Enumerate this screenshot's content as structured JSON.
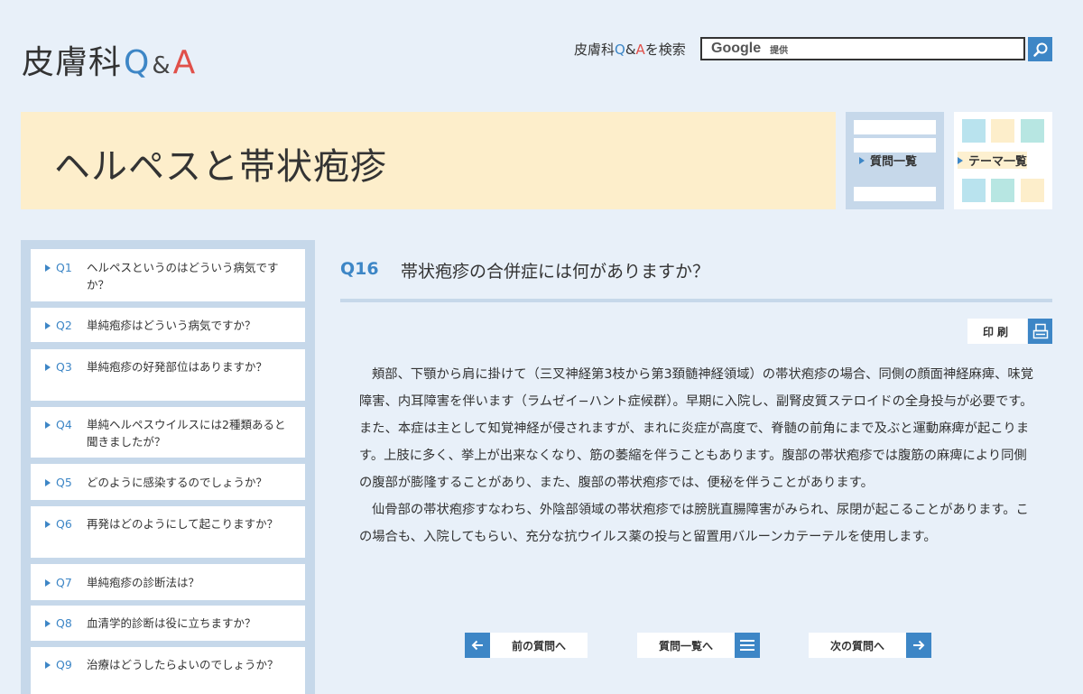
{
  "header": {
    "logo": {
      "main": "皮膚科",
      "q": "Q",
      "amp": "&",
      "a": "A"
    },
    "search": {
      "label_pre": "皮膚科",
      "label_q": "Q",
      "label_amp": "&",
      "label_a": "A",
      "label_post": "を検索",
      "brand": "Google",
      "brand_suffix": "提供"
    }
  },
  "banner": {
    "title": "ヘルペスと帯状疱疹",
    "question_list_label": "質問一覧",
    "theme_list_label": "テーマ一覧"
  },
  "sidebar": {
    "items": [
      {
        "num": "Q1",
        "text": "ヘルペスというのはどういう病気ですか？"
      },
      {
        "num": "Q2",
        "text": "単純疱疹はどういう病気ですか？"
      },
      {
        "num": "Q3",
        "text": "単純疱疹の好発部位はありますか？"
      },
      {
        "num": "Q4",
        "text": "単純ヘルペスウイルスには2種類あると聞きましたが？"
      },
      {
        "num": "Q5",
        "text": "どのように感染するのでしょうか？"
      },
      {
        "num": "Q6",
        "text": "再発はどのようにして起こりますか？"
      },
      {
        "num": "Q7",
        "text": "単純疱疹の診断法は？"
      },
      {
        "num": "Q8",
        "text": "血清学的診断は役に立ちますか？"
      },
      {
        "num": "Q9",
        "text": "治療はどうしたらよいのでしょうか？"
      }
    ]
  },
  "main": {
    "question_num": "Q16",
    "question_title": "帯状疱疹の合併症には何がありますか？",
    "print_label": "印刷",
    "paragraphs": [
      "頬部、下顎から肩に掛けて（三叉神経第3枝から第3頚髄神経領域）の帯状疱疹の場合、同側の顔面神経麻痺、味覚障害、内耳障害を伴います（ラムゼイ−ハント症候群）。早期に入院し、副腎皮質ステロイドの全身投与が必要です。また、本症は主として知覚神経が侵されますが、まれに炎症が高度で、脊髄の前角にまで及ぶと運動麻痺が起こります。上肢に多く、挙上が出来なくなり、筋の萎縮を伴うこともあります。腹部の帯状疱疹では腹筋の麻痺により同側の腹部が膨隆することがあり、また、腹部の帯状疱疹では、便秘を伴うことがあります。",
      "仙骨部の帯状疱疹すなわち、外陰部領域の帯状疱疹では膀胱直腸障害がみられ、尿閉が起こることがあります。この場合も、入院してもらい、充分な抗ウイルス薬の投与と留置用バルーンカテーテルを使用します。"
    ]
  },
  "pager": {
    "prev_label": "前の質問へ",
    "list_label": "質問一覧へ",
    "next_label": "次の質問へ"
  },
  "colors": {
    "accent_blue": "#3d86c6",
    "accent_red": "#e0504a",
    "banner_bg": "#fdeecb",
    "panel_bg": "#c6d8ea",
    "page_bg": "#e8f0f9"
  }
}
